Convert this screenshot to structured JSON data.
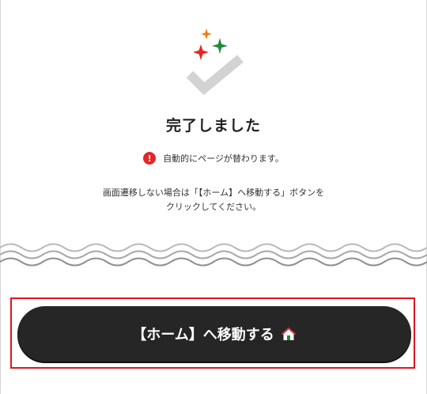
{
  "completion": {
    "title": "完了しました",
    "notice": "自動的にページが替わります。",
    "description_lines": [
      "画面遷移しない場合は「【ホーム】へ移動する」ボタンを",
      "クリックしてください。"
    ]
  },
  "action": {
    "home_button_label": "【ホーム】へ移動する"
  },
  "icons": {
    "alert": "!",
    "check": "checkmark-icon",
    "sparkles": "sparkle-icons",
    "home": "home-icon"
  },
  "colors": {
    "accent_red": "#e5252a",
    "sparkle_orange": "#f07a10",
    "sparkle_red": "#e8251e",
    "sparkle_green": "#1f8a3a",
    "check_gray": "#d3d3d3",
    "button_dark": "#262626",
    "highlight_border": "#e0141e"
  }
}
